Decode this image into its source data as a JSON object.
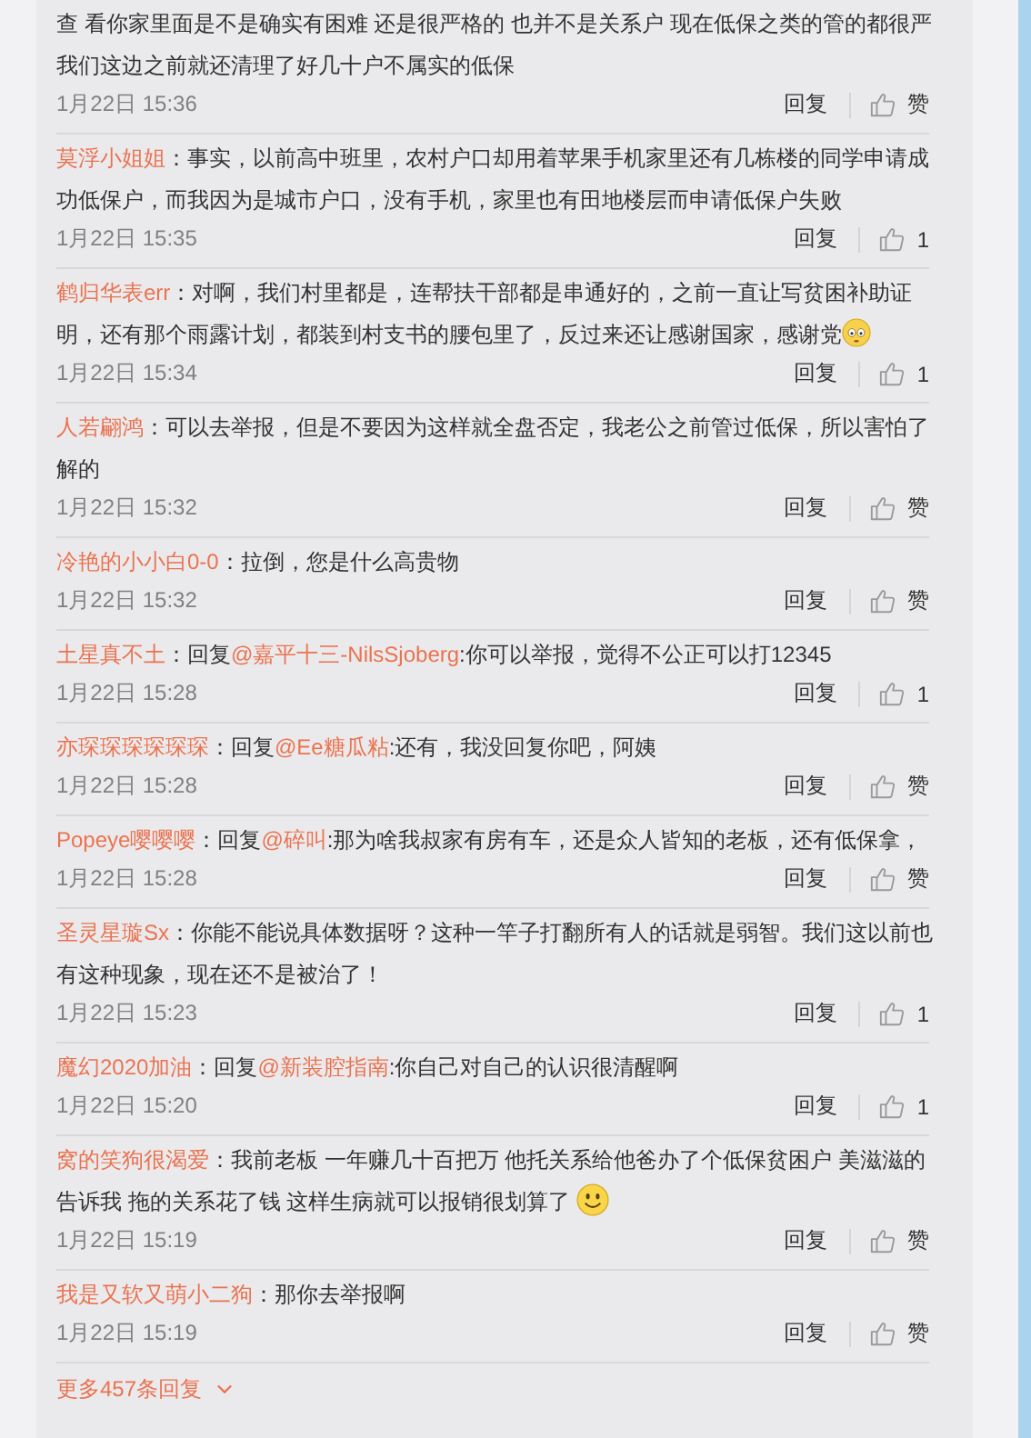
{
  "comments": [
    {
      "text": "查 看你家里面是不是确实有困难 还是很严格的 也并不是关系户 现在低保之类的管的都很严我们这边之前就还清理了好几十户不属实的低保",
      "time": "1月22日 15:36",
      "reply_label": "回复",
      "like": "赞"
    },
    {
      "user": "莫浮小姐姐",
      "text": "：事实，以前高中班里，农村户口却用着苹果手机家里还有几栋楼的同学申请成功低保户，而我因为是城市户口，没有手机，家里也有田地楼层而申请低保户失败",
      "time": "1月22日 15:35",
      "reply_label": "回复",
      "like": "1"
    },
    {
      "user": "鹤归华表err",
      "text": "：对啊，我们村里都是，连帮扶干部都是串通好的，之前一直让写贫困补助证明，还有那个雨露计划，都装到村支书的腰包里了，反过来还让感谢国家，感谢党",
      "emoji": {
        "kind": "wide-eyed"
      },
      "time": "1月22日 15:34",
      "reply_label": "回复",
      "like": "1"
    },
    {
      "user": "人若翩鸿",
      "text": "：可以去举报，但是不要因为这样就全盘否定，我老公之前管过低保，所以害怕了解的",
      "time": "1月22日 15:32",
      "reply_label": "回复",
      "like": "赞"
    },
    {
      "user": "冷艳的小小白0-0",
      "text": "：拉倒，您是什么高贵物",
      "time": "1月22日 15:32",
      "reply_label": "回复",
      "like": "赞"
    },
    {
      "user": "土星真不土",
      "prefix": "：回复",
      "mention": "@嘉平十三-NilsSjoberg",
      "text": ":你可以举报，觉得不公正可以打12345",
      "time": "1月22日 15:28",
      "reply_label": "回复",
      "like": "1"
    },
    {
      "user": "亦琛琛琛琛琛琛",
      "prefix": "：回复",
      "mention": "@Ee糖瓜粘",
      "text": ":还有，我没回复你吧，阿姨",
      "time": "1月22日 15:28",
      "reply_label": "回复",
      "like": "赞"
    },
    {
      "user": "Popeye嘤嘤嘤",
      "prefix": "：回复",
      "mention": "@碎叫",
      "text": ":那为啥我叔家有房有车，还是众人皆知的老板，还有低保拿，",
      "time": "1月22日 15:28",
      "reply_label": "回复",
      "like": "赞"
    },
    {
      "user": "圣灵星璇Sx",
      "text": "：你能不能说具体数据呀？这种一竿子打翻所有人的话就是弱智。我们这以前也有这种现象，现在还不是被治了！",
      "time": "1月22日 15:23",
      "reply_label": "回复",
      "like": "1"
    },
    {
      "user": "魔幻2020加油",
      "prefix": "：回复",
      "mention": "@新装腔指南",
      "text": ":你自己对自己的认识很清醒啊",
      "time": "1月22日 15:20",
      "reply_label": "回复",
      "like": "1"
    },
    {
      "user": "窝的笑狗很渴爱",
      "text": "：我前老板 一年赚几十百把万  他托关系给他爸办了个低保贫困户 美滋滋的告诉我 拖的关系花了钱 这样生病就可以报销很划算了 ",
      "emoji": {
        "kind": "smile"
      },
      "time": "1月22日 15:19",
      "reply_label": "回复",
      "like": "赞"
    },
    {
      "user": "我是又软又萌小二狗",
      "text": "：那你去举报啊",
      "time": "1月22日 15:19",
      "reply_label": "回复",
      "like": "赞"
    }
  ],
  "more": {
    "label": "更多457条回复"
  }
}
